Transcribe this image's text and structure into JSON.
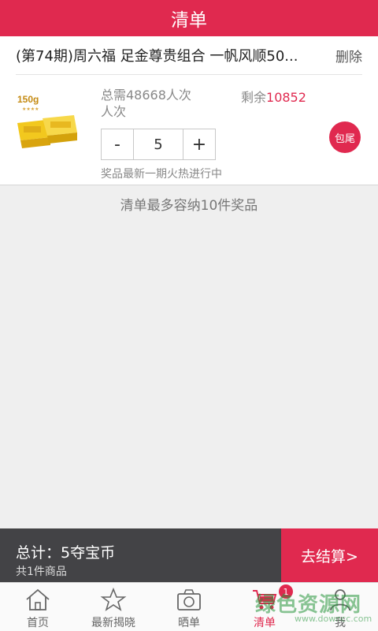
{
  "header": {
    "title": "清单"
  },
  "item": {
    "title": "(第74期)周六福 足金尊贵组合 一帆风顺50...",
    "delete_label": "删除",
    "need_text": "总需48668人次",
    "need_unit": "人次",
    "remain_label": "剩余",
    "remain_value": "10852",
    "quantity": "5",
    "minus_label": "-",
    "plus_label": "+",
    "note": "奖品最新一期火热进行中",
    "badge": "包尾",
    "image_label": "150g"
  },
  "capacity_note": "清单最多容纳10件奖品",
  "checkout": {
    "total": "总计：5夺宝币",
    "count": "共1件商品",
    "button": "去结算>"
  },
  "tabs": [
    {
      "label": "首页",
      "icon": "home-icon"
    },
    {
      "label": "最新揭晓",
      "icon": "star-icon"
    },
    {
      "label": "晒单",
      "icon": "camera-icon"
    },
    {
      "label": "清单",
      "icon": "cart-icon",
      "active": true,
      "badge": "1"
    },
    {
      "label": "我",
      "icon": "person-icon"
    }
  ],
  "watermark": {
    "main": "绿色资源网",
    "sub": "www.downcc.com"
  },
  "colors": {
    "accent": "#e0294f",
    "checkout_bg": "#434346"
  }
}
